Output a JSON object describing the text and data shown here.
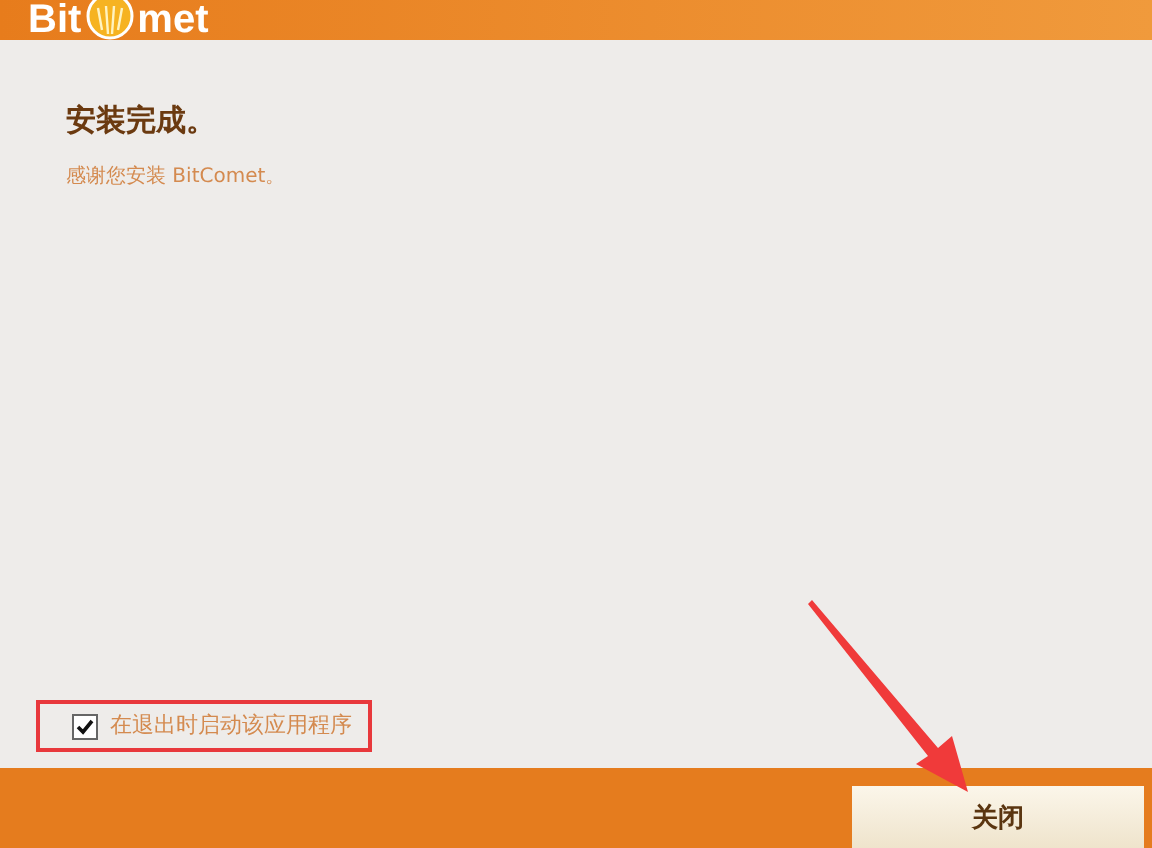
{
  "header": {
    "logo_left": "Bit",
    "logo_right": "met"
  },
  "title": "安装完成。",
  "message": "感谢您安装 BitComet。",
  "launch_option": {
    "label": "在退出时启动该应用程序",
    "checked": true
  },
  "buttons": [
    "关闭"
  ]
}
